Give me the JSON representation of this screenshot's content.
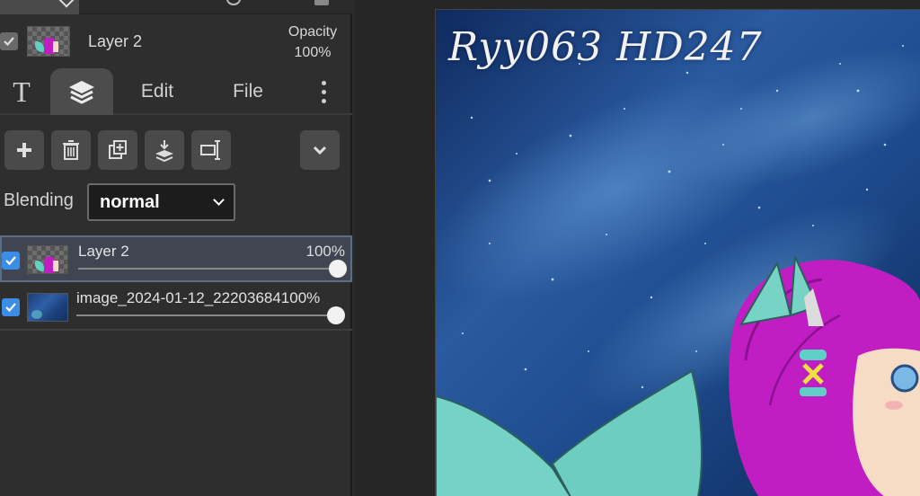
{
  "active_layer": {
    "name": "Layer 2",
    "opacity_label": "Opacity",
    "opacity_value": "100%"
  },
  "tabs": [
    {
      "label": "T",
      "icon": "text-tool-icon"
    },
    {
      "label": "",
      "icon": "layers-icon",
      "active": true
    },
    {
      "label": "Edit"
    },
    {
      "label": "File"
    },
    {
      "label": "",
      "icon": "more-vertical-icon"
    }
  ],
  "toolbar": {
    "buttons": [
      "add-layer-icon",
      "delete-layer-icon",
      "duplicate-layer-icon",
      "merge-down-icon",
      "layer-properties-icon",
      "chevron-down-icon"
    ]
  },
  "blending": {
    "label": "Blending",
    "value": "normal"
  },
  "layers": [
    {
      "name": "Layer 2",
      "opacity": "100%",
      "opacity_level": 1.0,
      "visible": true,
      "selected": true
    },
    {
      "name": "image_2024-01-12_22203684100%",
      "opacity": "",
      "opacity_level": 1.0,
      "visible": true,
      "selected": false
    }
  ],
  "canvas": {
    "title": "Ryy063 HD247"
  },
  "colors": {
    "accent_check": "#3a8ee6",
    "panel": "#2e2e2e",
    "sky": "#1f4c8f",
    "hair": "#c21cc4",
    "teal": "#62d1c4"
  }
}
